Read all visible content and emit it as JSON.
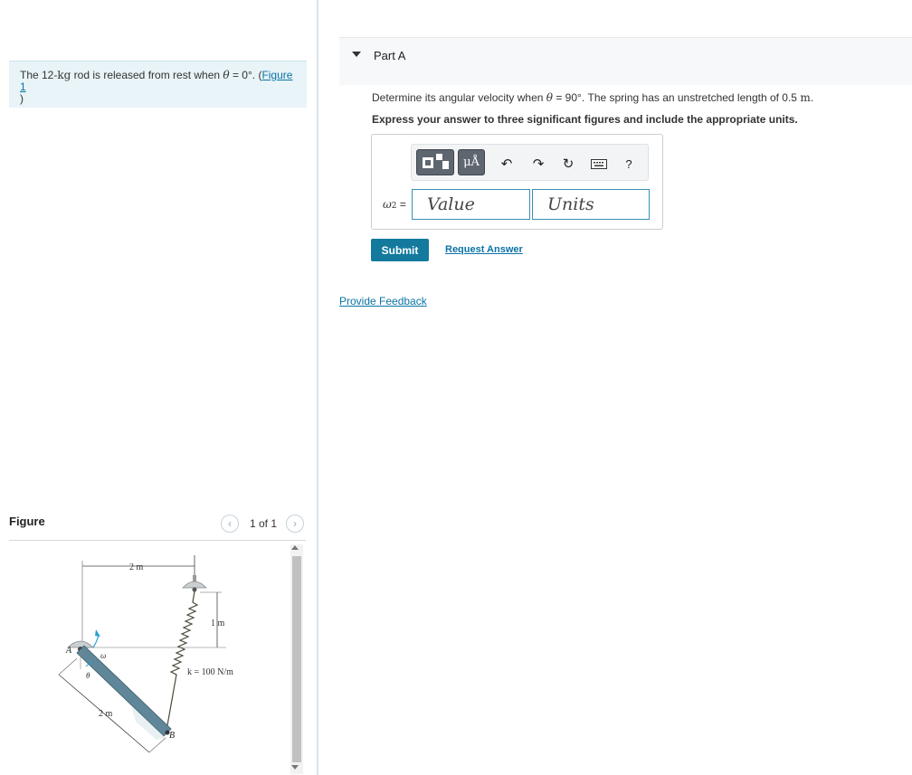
{
  "problem": {
    "intro_before": "The 12-",
    "intro_kg": "kg",
    "intro_middle": " rod is released from rest when ",
    "theta": "θ",
    "intro_eq": " = 0°. (",
    "figure_link": "Figure 1",
    "intro_close": ")"
  },
  "figure": {
    "title": "Figure",
    "count": "1 of 1",
    "prev_icon": "chevron-left",
    "next_icon": "chevron-right",
    "labels": {
      "span_top": "2 m",
      "spring_len": "1 m",
      "k": "k = 100 N/m",
      "rod_len": "2 m",
      "point_a": "A",
      "point_b": "B",
      "omega": "ω",
      "theta": "θ"
    }
  },
  "part": {
    "title": "Part A",
    "question_before": "Determine its angular velocity when ",
    "theta": "θ",
    "question_mid": " = 90°. The spring has an unstretched length of 0.5 ",
    "question_unit": "m",
    "question_end": ".",
    "instructions": "Express your answer to three significant figures and include the appropriate units."
  },
  "answer": {
    "label_main": "ω",
    "label_sub": "2",
    "label_eq": " =",
    "value_placeholder": "Value",
    "units_placeholder": "Units",
    "toolbar": [
      "templates-icon",
      "units-mu-a-icon",
      "undo-icon",
      "redo-icon",
      "reset-icon",
      "keyboard-icon",
      "help-icon"
    ],
    "units_button": "μÅ",
    "help_button": "?"
  },
  "actions": {
    "submit": "Submit",
    "request_answer": "Request Answer",
    "provide_feedback": "Provide Feedback"
  },
  "colors": {
    "accent": "#137a9e",
    "link": "#0b73a6",
    "intro_bg": "#e8f4f7"
  }
}
